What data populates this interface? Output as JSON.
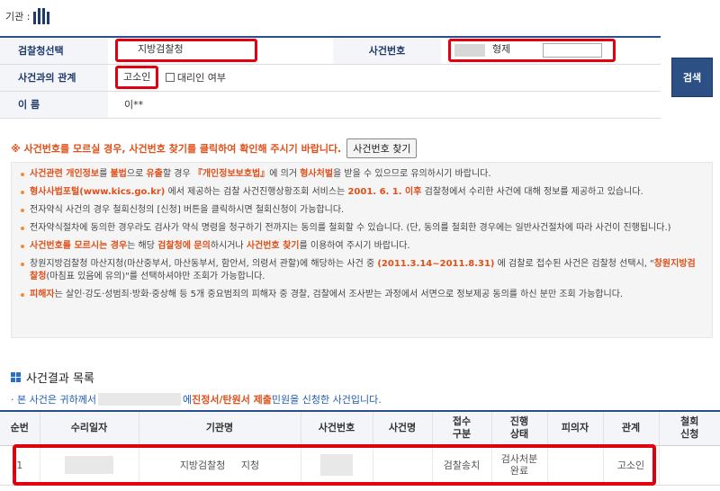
{
  "agency": {
    "label": "기관 :"
  },
  "search": {
    "office_label": "검찰청선택",
    "office_value": "지방검찰청",
    "case_no_label": "사건번호",
    "case_no_type": "형제",
    "relation_label": "사건과의 관계",
    "relation_value": "고소인",
    "proxy_label": "대리인 여부",
    "name_label": "이 름",
    "name_value": "이**",
    "search_button": "검색"
  },
  "notice": {
    "text": "※ 사건번호를 모르실 경우, 사건번호 찾기를 클릭하여 확인해 주시기 바랍니다.",
    "find_button": "사건번호 찾기"
  },
  "info": {
    "items": [
      {
        "parts": [
          {
            "t": "사건관련 개인정보",
            "o": true
          },
          {
            "t": "를 "
          },
          {
            "t": "불법",
            "o": true
          },
          {
            "t": "으로 "
          },
          {
            "t": "유출",
            "o": true
          },
          {
            "t": "할 경우 "
          },
          {
            "t": "『개인정보보호법』",
            "o": true
          },
          {
            "t": "에 의거 "
          },
          {
            "t": "형사처벌",
            "o": true
          },
          {
            "t": "을 받을 수 있으므로 유의하시기 바랍니다."
          }
        ]
      },
      {
        "parts": [
          {
            "t": "형사사법포털(www.kics.go.kr)",
            "o": true
          },
          {
            "t": " 에서 제공하는 검찰 사건진행상황조회 서비스는 "
          },
          {
            "t": "2001. 6. 1. 이후",
            "o": true
          },
          {
            "t": " 검찰청에서 수리한 사건에 대해 정보를 제공하고 있습니다."
          }
        ]
      },
      {
        "parts": [
          {
            "t": "전자약식 사건의 경우 철회신청의 [신청] 버튼을 클릭하시면 철회신청이 가능합니다."
          }
        ]
      },
      {
        "parts": [
          {
            "t": "전자약식절차에 동의한 경우라도 검사가 약식 명령을 청구하기 전까지는 동의를 철회할 수 있습니다. (단, 동의를 철회한 경우에는 일반사건절차에 따라 사건이 진행됩니다.)"
          }
        ]
      },
      {
        "parts": [
          {
            "t": "사건번호를 모르시는 경우",
            "o": true
          },
          {
            "t": "는 해당 "
          },
          {
            "t": "검찰청에 문의",
            "o": true
          },
          {
            "t": "하시거나 "
          },
          {
            "t": "사건번호 찾기",
            "o": true
          },
          {
            "t": "를 이용하여 주시기 바랍니다."
          }
        ]
      },
      {
        "parts": [
          {
            "t": "창원지방검찰청 마산지청(마산중부서, 마산동부서, 함안서, 의령서 관할)에 해당하는 사건 중 "
          },
          {
            "t": "(2011.3.14~2011.8.31)",
            "o": true
          },
          {
            "t": " 에 검찰로 접수된 사건은 검찰청 선택시, \""
          },
          {
            "t": "창원지방검찰청",
            "o": true
          },
          {
            "t": "(마침표 있음에 유의)\"를 선택하셔야만 조회가 가능합니다."
          }
        ]
      },
      {
        "parts": [
          {
            "t": "피해자",
            "o": true
          },
          {
            "t": "는 살인·강도·성범죄·방화·중상해 등 5개 중요범죄의 피해자 중 경찰, 검찰에서 조사받는 과정에서 서면으로 정보제공 동의를 하신 분만 조회 가능합니다."
          }
        ]
      }
    ]
  },
  "results": {
    "title": "사건결과 목록",
    "sub_prefix": "· 본 사건은 귀하께서",
    "sub_mid": "에 ",
    "sub_bold": "진정서/탄원서 제출",
    "sub_suffix": " 민원을 신청한 사건입니다.",
    "columns": [
      "순번",
      "수리일자",
      "기관명",
      "사건번호",
      "사건명",
      "접수\n구분",
      "진행\n상태",
      "피의자",
      "관계",
      "철회\n신청"
    ],
    "rows": [
      {
        "no": "1",
        "date": "",
        "office": "지방검찰청",
        "office2": "지청",
        "case_no": "",
        "case_name": "",
        "intake": "검찰송치",
        "status": "검사처분\n완료",
        "suspect": "",
        "relation": "고소인",
        "withdraw": ""
      }
    ]
  },
  "colors": {
    "accent": "#2a4f8c",
    "highlight": "#e0000f",
    "warning": "#e0501a"
  }
}
